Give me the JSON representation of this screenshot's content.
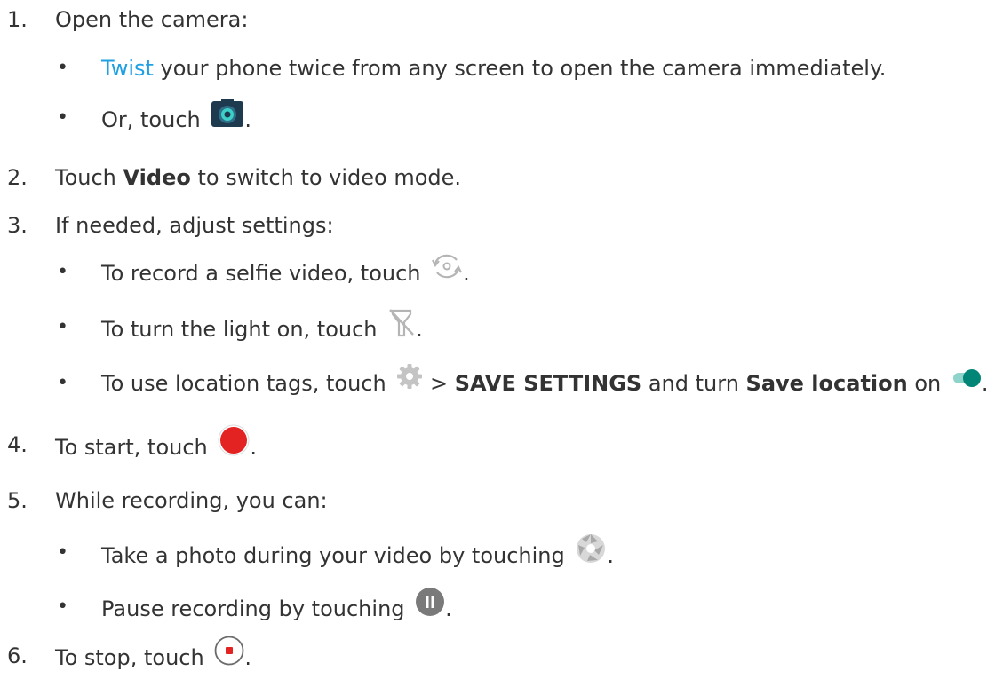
{
  "steps": [
    {
      "num": "1.",
      "text": "Open the camera:"
    },
    {
      "num": "2.",
      "pre": "Touch ",
      "bold": "Video",
      "post": " to switch to video mode."
    },
    {
      "num": "3.",
      "text": "If needed, adjust settings:"
    },
    {
      "num": "4.",
      "pre": "To start, touch ",
      "post": "."
    },
    {
      "num": "5.",
      "text": "While recording, you can:"
    },
    {
      "num": "6.",
      "pre": "To stop, touch ",
      "post": "."
    }
  ],
  "sub": {
    "twist": {
      "link": "Twist",
      "post": " your phone twice from any screen to open the camera immediately."
    },
    "or_touch": {
      "pre": "Or, touch ",
      "post": "."
    },
    "selfie": {
      "pre": "To record a selfie video, touch ",
      "post": "."
    },
    "light": {
      "pre": "To turn the light on, touch ",
      "post": "."
    },
    "location": {
      "pre": "To use location tags, touch ",
      "gt": " > ",
      "bold1": "SAVE SETTINGS",
      "mid": " and turn ",
      "bold2": "Save location",
      "on": " on ",
      "post": "."
    },
    "photo": {
      "pre": "Take a photo during your video by touching ",
      "post": "."
    },
    "pause": {
      "pre": "Pause recording by touching ",
      "post": "."
    }
  },
  "bullet": "•",
  "icons": {
    "camera": "camera-icon",
    "switch_camera": "switch-camera-icon",
    "flashlight": "flashlight-off-icon",
    "settings": "gear-icon",
    "toggle": "toggle-on-icon",
    "record": "record-button-icon",
    "shutter": "shutter-icon",
    "pause": "pause-icon",
    "stop": "stop-icon"
  },
  "colors": {
    "link": "#1fa0e2",
    "record": "#e32222",
    "toggle": "#008577",
    "text": "#333333"
  }
}
